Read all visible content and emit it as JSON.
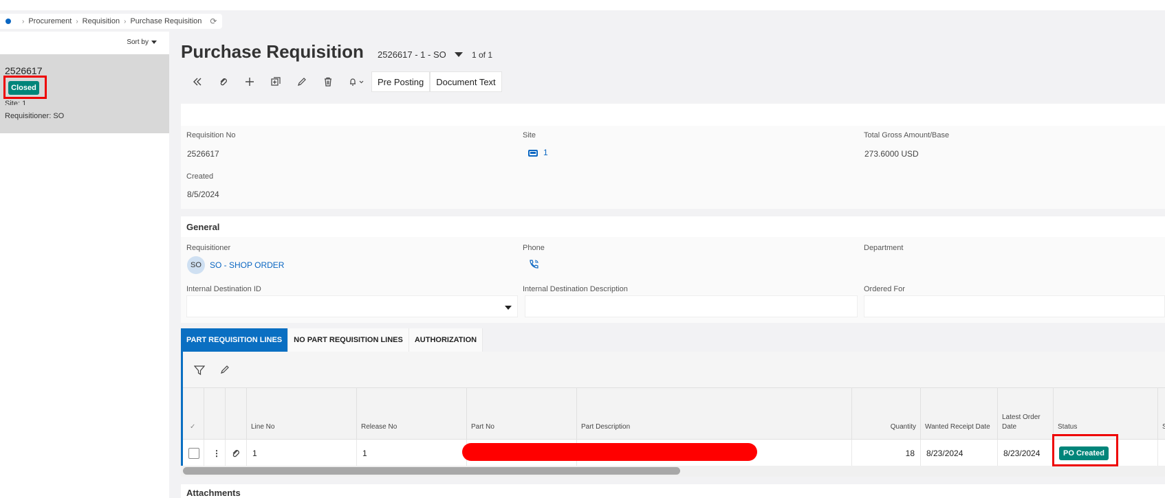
{
  "breadcrumb": {
    "items": [
      "Procurement",
      "Requisition",
      "Purchase Requisition"
    ]
  },
  "list": {
    "sort_label": "Sort by",
    "card": {
      "id": "2526617",
      "status": "Closed",
      "site": "Site:   1",
      "requisitioner": "Requisitioner:   SO"
    }
  },
  "header": {
    "title": "Purchase Requisition",
    "record": "2526617 - 1 - SO",
    "count": "1 of 1"
  },
  "toolbar": {
    "pre_posting": "Pre Posting",
    "document_text": "Document Text"
  },
  "summary": {
    "requisition_no_label": "Requisition No",
    "requisition_no": "2526617",
    "site_label": "Site",
    "site": "1",
    "total_label": "Total Gross Amount/Base",
    "total": "273.6000 USD",
    "created_label": "Created",
    "created": "8/5/2024"
  },
  "general": {
    "title": "General",
    "requisitioner_label": "Requisitioner",
    "avatar": "SO",
    "requisitioner": "SO - SHOP ORDER",
    "phone_label": "Phone",
    "department_label": "Department",
    "internal_dest_id_label": "Internal Destination ID",
    "internal_dest_desc_label": "Internal Destination Description",
    "ordered_for_label": "Ordered For"
  },
  "tabs": [
    "PART REQUISITION LINES",
    "NO PART REQUISITION LINES",
    "AUTHORIZATION"
  ],
  "grid": {
    "check_header": "✓",
    "columns": [
      "Line No",
      "Release No",
      "Part No",
      "Part Description",
      "Quantity",
      "Wanted Receipt Date",
      "Latest Order Date",
      "Status",
      "S"
    ],
    "row": {
      "line_no": "1",
      "release_no": "1",
      "quantity": "18",
      "wanted_receipt_date": "8/23/2024",
      "latest_order_date": "8/23/2024",
      "status": "PO Created"
    }
  },
  "attachments": {
    "title": "Attachments"
  },
  "colors": {
    "accent": "#0a6fc2",
    "status_green": "#00857a",
    "highlight_red": "#e00000"
  }
}
